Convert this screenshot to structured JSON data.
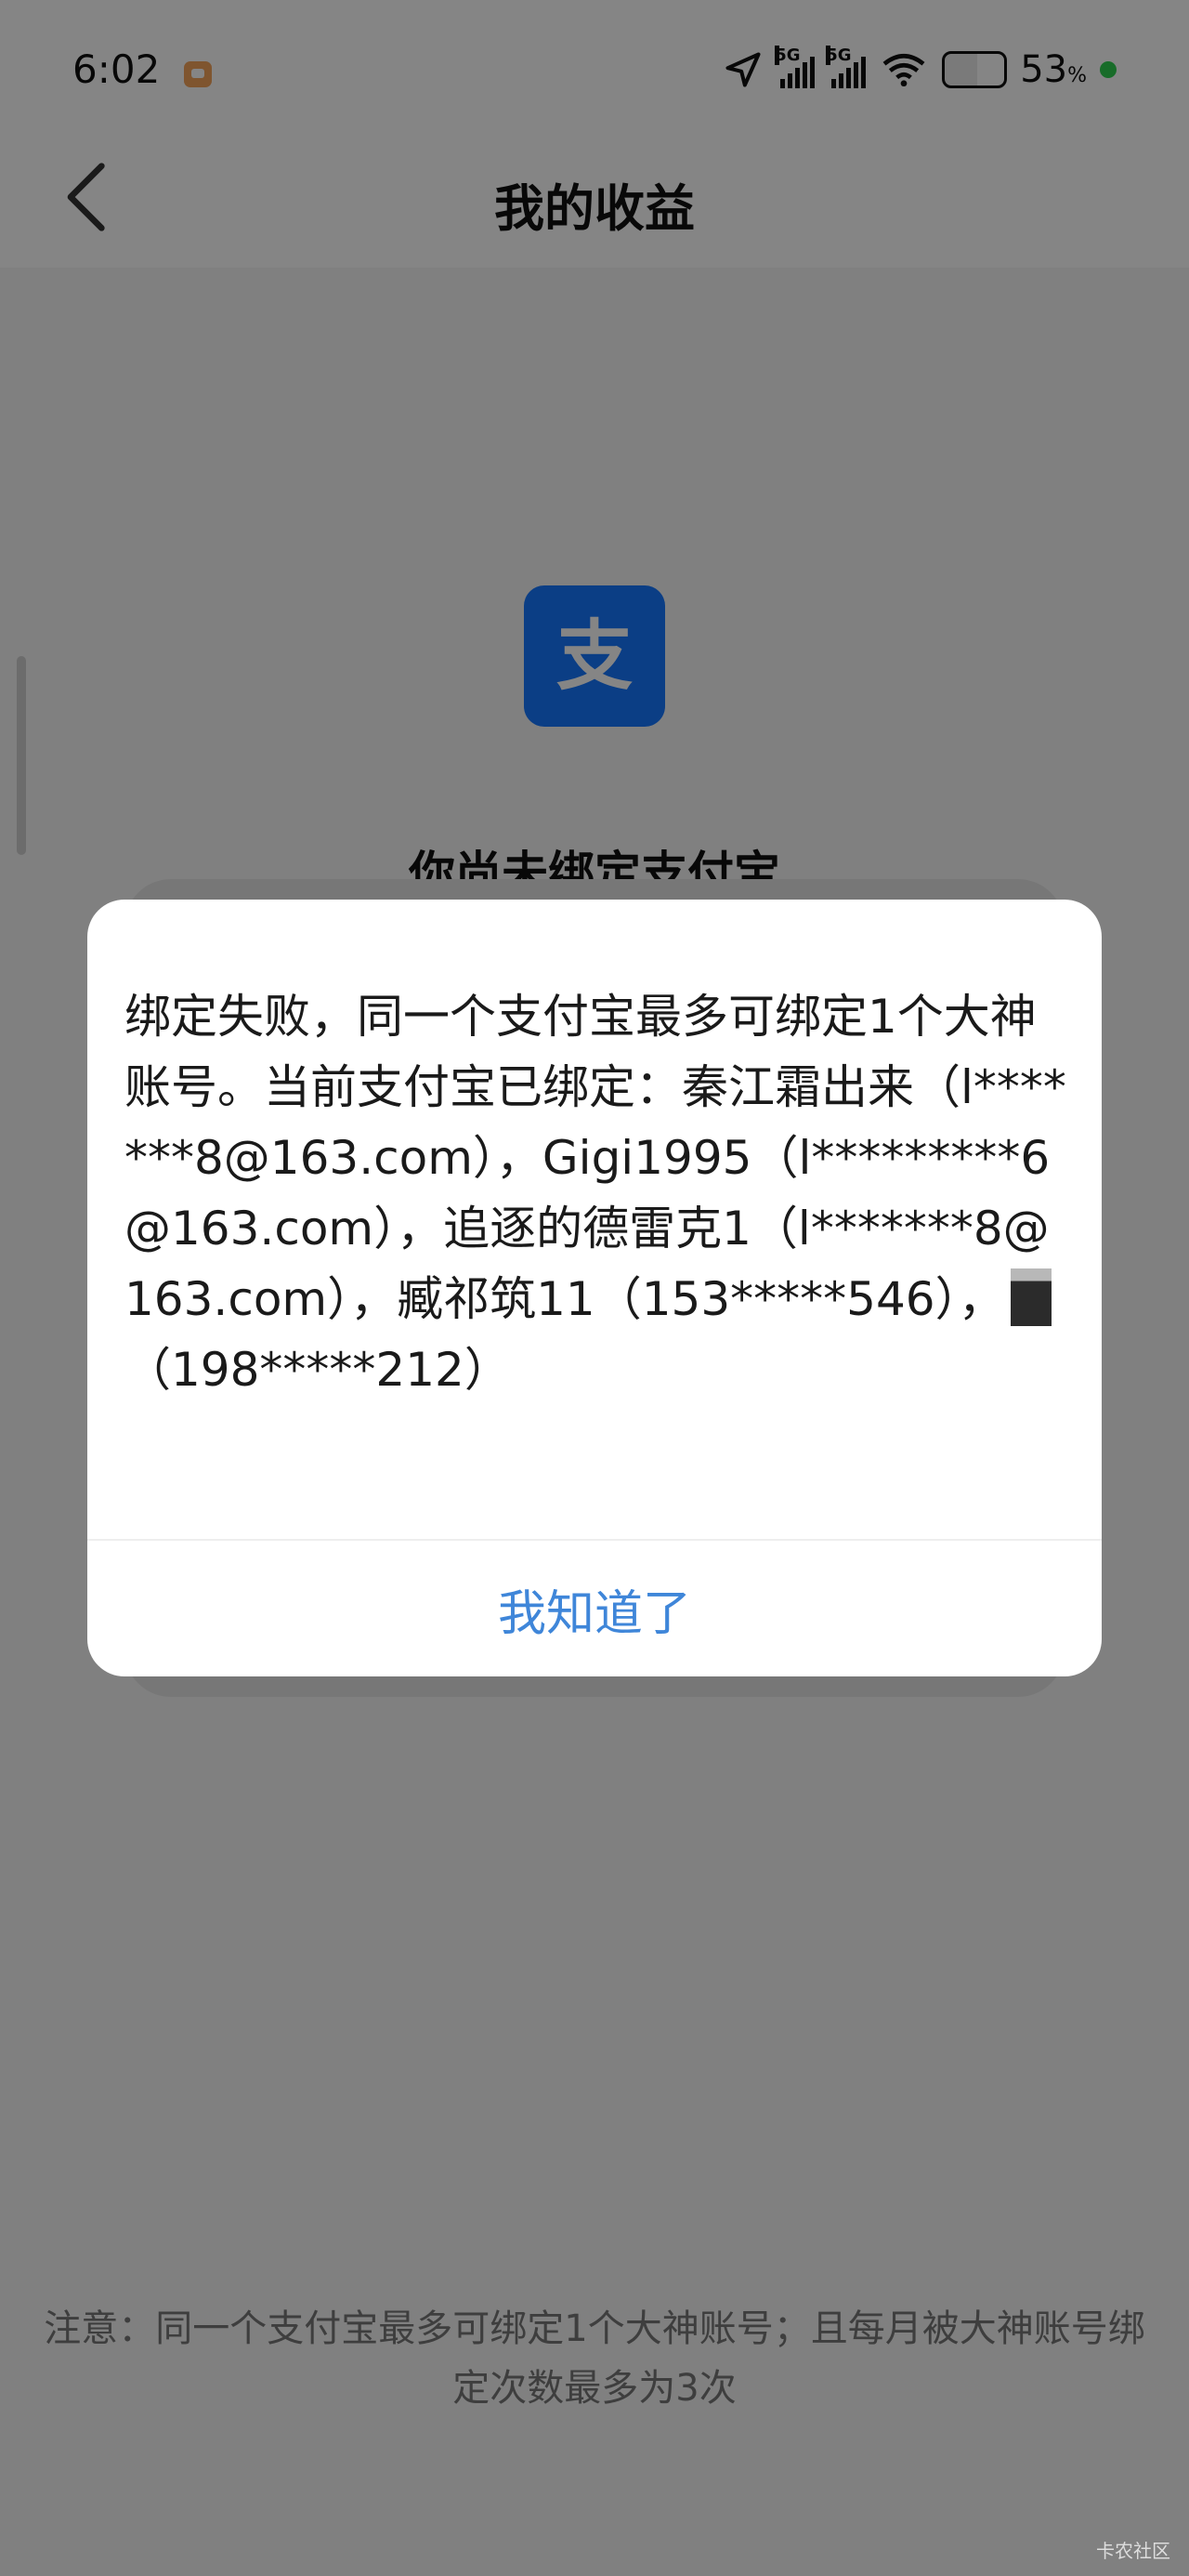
{
  "status_bar": {
    "time": "6:02",
    "signal_1_label": "5G",
    "signal_2_label": "5G",
    "battery_percent": "53",
    "battery_unit": "%"
  },
  "header": {
    "title": "我的收益"
  },
  "background": {
    "heading": "你尚未绑定支付宝",
    "note": "注意：同一个支付宝最多可绑定1个大神账号；且每月被大神账号绑定次数最多为3次",
    "logo_char": "支"
  },
  "dialog": {
    "message": "绑定失败，同一个支付宝最多可绑定1个大神账号。当前支付宝已绑定：秦江霜出来（l*******8@163.com），Gigi1995（l*********6@163.com），追逐的德雷克1（l*******8@163.com），臧祁筑11（153*****546），",
    "message_tail": "（198*****212）",
    "confirm_label": "我知道了"
  },
  "watermark": "卡农社区",
  "colors": {
    "alipay_blue": "#1677ff",
    "button_blue": "#3f86d9",
    "overlay": "rgba(0,0,0,0.48)"
  }
}
